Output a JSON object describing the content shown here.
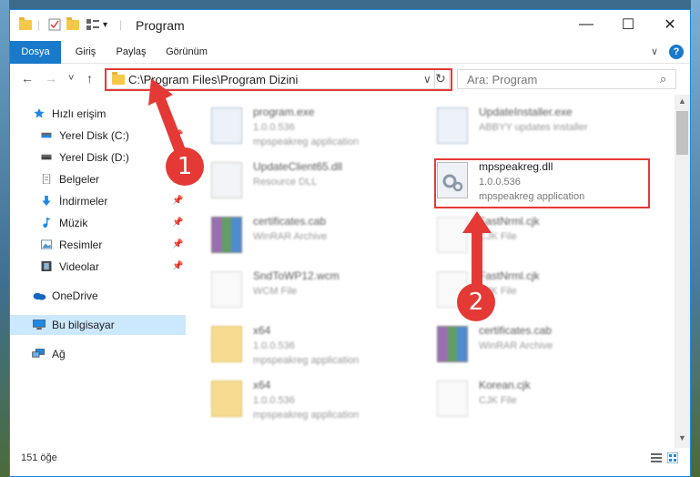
{
  "window": {
    "title": "Program",
    "minimize_glyph": "—",
    "maximize_glyph": "☐",
    "close_glyph": "✕"
  },
  "ribbon": {
    "tabs": [
      "Dosya",
      "Giriş",
      "Paylaş",
      "Görünüm"
    ],
    "help_glyph": "?",
    "collapse_glyph": "∨"
  },
  "nav": {
    "back_glyph": "←",
    "forward_glyph": "→",
    "recent_glyph": "˅",
    "up_glyph": "↑",
    "address": "C:\\Program Files\\Program Dizini",
    "refresh_glyph": "↻",
    "dropdown_glyph": "∨",
    "search_placeholder": "Ara: Program",
    "search_glyph": "⌕"
  },
  "sidebar": {
    "items": [
      {
        "label": "Hızlı erişim",
        "icon": "star-icon",
        "color": "#1e88e5"
      },
      {
        "label": "Yerel Disk (C:)",
        "icon": "drive-icon",
        "color": "#555555"
      },
      {
        "label": "Yerel Disk (D:)",
        "icon": "drive-icon",
        "color": "#555555"
      },
      {
        "label": "Belgeler",
        "icon": "documents-icon",
        "color": "#9e9e9e"
      },
      {
        "label": "İndirmeler",
        "icon": "download-icon",
        "color": "#1e88e5"
      },
      {
        "label": "Müzik",
        "icon": "music-icon",
        "color": "#1e88e5"
      },
      {
        "label": "Resimler",
        "icon": "pictures-icon",
        "color": "#4a90c8"
      },
      {
        "label": "Videolar",
        "icon": "video-icon",
        "color": "#444444"
      },
      {
        "label": "OneDrive",
        "icon": "cloud-icon",
        "color": "#1565c0"
      },
      {
        "label": "Bu bilgisayar",
        "icon": "computer-icon",
        "color": "#1e88e5"
      },
      {
        "label": "Ağ",
        "icon": "network-icon",
        "color": "#1e88e5"
      }
    ],
    "pin_glyph": "📌"
  },
  "files": [
    {
      "name": "program.exe",
      "line2": "1.0.0.536",
      "line3": "mpspeakreg application",
      "icon": "exe-icon",
      "blurred": true
    },
    {
      "name": "UpdateInstaller.exe",
      "line2": "ABBYY updates installer",
      "line3": "",
      "icon": "exe-icon",
      "blurred": true
    },
    {
      "name": "UpdateClient65.dll",
      "line2": "Resource DLL",
      "line3": "",
      "icon": "dll-icon",
      "blurred": true
    },
    {
      "name": "mpspeakreg.dll",
      "line2": "1.0.0.536",
      "line3": "mpspeakreg application",
      "icon": "dll-icon",
      "blurred": false
    },
    {
      "name": "certificates.cab",
      "line2": "WinRAR Archive",
      "line3": "",
      "icon": "archive-icon",
      "blurred": true
    },
    {
      "name": "FastNrml.cjk",
      "line2": "CJK File",
      "line3": "",
      "icon": "file-icon",
      "blurred": true
    },
    {
      "name": "SndToWP12.wcm",
      "line2": "WCM File",
      "line3": "",
      "icon": "file-icon",
      "blurred": true
    },
    {
      "name": "FastNrml.cjk",
      "line2": "CJK File",
      "line3": "",
      "icon": "file-icon",
      "blurred": true
    },
    {
      "name": "x64",
      "line2": "1.0.0.536",
      "line3": "mpspeakreg application",
      "icon": "folder-icon",
      "blurred": true
    },
    {
      "name": "certificates.cab",
      "line2": "WinRAR Archive",
      "line3": "",
      "icon": "archive-icon",
      "blurred": true
    },
    {
      "name": "x64",
      "line2": "1.0.0.536",
      "line3": "mpspeakreg application",
      "icon": "folder-icon",
      "blurred": true
    },
    {
      "name": "Korean.cjk",
      "line2": "CJK File",
      "line3": "",
      "icon": "file-icon",
      "blurred": true
    }
  ],
  "status": {
    "item_count": "151 öğe"
  },
  "annotations": {
    "marker1": "1",
    "marker2": "2",
    "color": "#e53935"
  }
}
